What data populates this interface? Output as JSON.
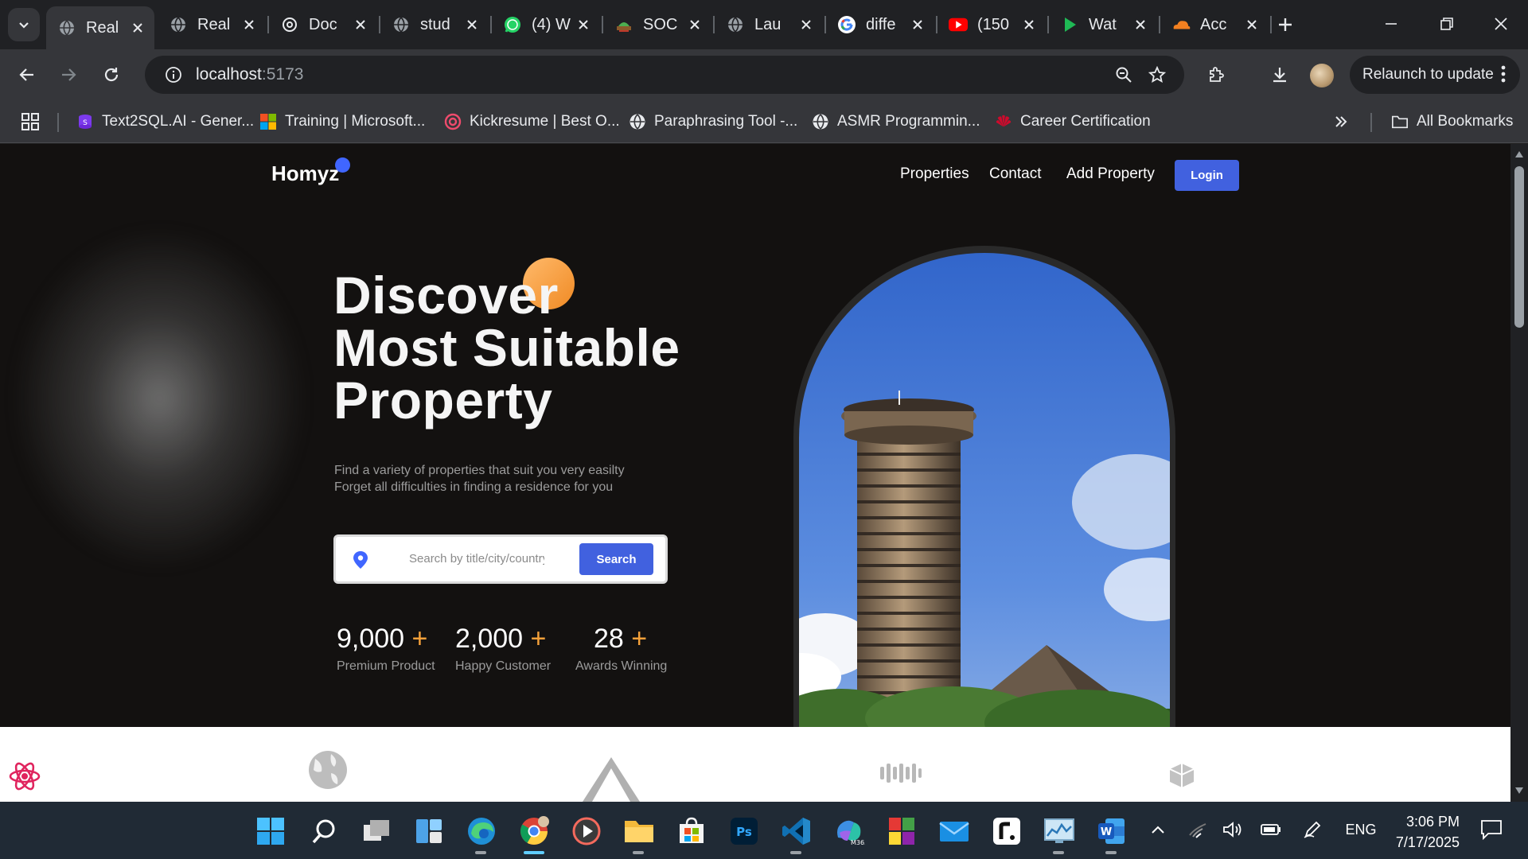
{
  "browser": {
    "tabs": [
      {
        "title": "Real",
        "icon": "globe-icon",
        "active": true
      },
      {
        "title": "Real",
        "icon": "globe-icon"
      },
      {
        "title": "Doc",
        "icon": "openai-icon"
      },
      {
        "title": "stud",
        "icon": "globe-icon"
      },
      {
        "title": "(4) W",
        "icon": "whatsapp-icon"
      },
      {
        "title": "SOC",
        "icon": "soc-icon"
      },
      {
        "title": "Lau",
        "icon": "globe-icon"
      },
      {
        "title": "diffe",
        "icon": "google-icon"
      },
      {
        "title": "(150",
        "icon": "youtube-icon"
      },
      {
        "title": "Wat",
        "icon": "play-icon"
      },
      {
        "title": "Acc",
        "icon": "cloudflare-icon"
      }
    ],
    "address": {
      "host": "localhost",
      "port": ":5173"
    },
    "relaunch_label": "Relaunch to update",
    "bookmarks": [
      {
        "label": "Text2SQL.AI - Gener...",
        "icon": "text2sql-icon"
      },
      {
        "label": "Training | Microsoft...",
        "icon": "microsoft-icon"
      },
      {
        "label": "Kickresume | Best O...",
        "icon": "kickresume-icon"
      },
      {
        "label": "Paraphrasing Tool -...",
        "icon": "globe-icon"
      },
      {
        "label": "ASMR Programmin...",
        "icon": "globe-icon"
      },
      {
        "label": "Career Certification",
        "icon": "huawei-icon"
      }
    ],
    "all_bookmarks_label": "All Bookmarks"
  },
  "site": {
    "logo": "Homyz",
    "nav": [
      "Properties",
      "Contact",
      "Add Property"
    ],
    "login_label": "Login",
    "headline": [
      "Discover",
      "Most Suitable",
      "Property"
    ],
    "subtitle": [
      "Find a variety of properties that suit you very easilty",
      "Forget all difficulties in finding a residence for you"
    ],
    "search": {
      "placeholder": "Search by title/city/country",
      "button": "Search"
    },
    "stats": [
      {
        "value": "9,000",
        "plus": "+",
        "label": "Premium Product"
      },
      {
        "value": "2,000",
        "plus": "+",
        "label": "Happy Customer"
      },
      {
        "value": "28",
        "plus": "+",
        "label": "Awards Winning"
      }
    ],
    "colors": {
      "accent": "#4161df",
      "orange": "#f5a13a",
      "hero_bg": "#131110"
    }
  },
  "taskbar": {
    "language": "ENG",
    "time": "3:06 PM",
    "date": "7/17/2025"
  }
}
